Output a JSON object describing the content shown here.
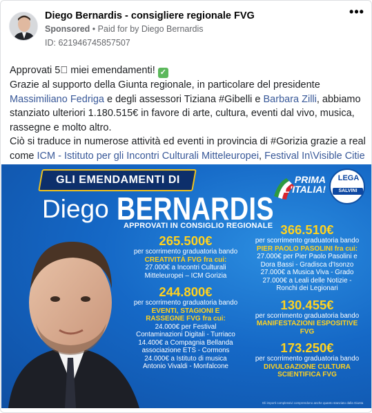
{
  "post": {
    "page_name": "Diego Bernardis - consigliere regionale FVG",
    "sponsored": "Sponsored",
    "paid_for": "Paid for by Diego Bernardis",
    "separator": "•",
    "ad_id": "ID: 621946745857507",
    "more_label": "•••"
  },
  "body": {
    "l1": "Approvati 5⃣ miei emendamenti!",
    "l2": "Grazie al supporto della Giunta regionale, in particolare del presidente",
    "l3_link1": "Massimiliano Fedriga",
    "l3_mid": " e degli assessori Tiziana #Gibelli e ",
    "l3_link2": "Barbara Zilli",
    "l3_end": ", abbiamo",
    "l4": "stanziato ulteriori 1.180.515€ in favore di arte, cultura, eventi dal vivo, musica,",
    "l5": "rassegne e molto altro.",
    "l6": "Ciò si traduce in numerose attività ed eventi in provincia di #Gorizia grazie a realtà",
    "l7_start": "come ",
    "l7_link1": "ICM - Istituto per gli Incontri Culturali Mitteleuropei",
    "l7_mid": ", ",
    "l7_link2": "Festival In\\Visible Citie…"
  },
  "creative": {
    "banner": "GLI EMENDAMENTI DI",
    "first_name": "Diego",
    "last_name": "BERNARDIS",
    "subtitle": "APPROVATI IN CONSIGLIO REGIONALE",
    "prima_line1": "PRIMA",
    "prima_line2": "L'ITALIA!",
    "lega": "LEGA",
    "salvini": "SALVINI",
    "footnote": "Gli importi complessivi comprendono anche quanto stanziato dalla Giunta",
    "left": [
      {
        "amount": "265.500€",
        "d1": "per scorrimento graduatoria bando",
        "hl": [
          "CREATIVITÀ FVG fra cui:"
        ],
        "rest": [
          "27.000€ a Incontri Culturali",
          "Mitteleuropei – ICM Gorizia"
        ]
      },
      {
        "amount": "244.800€",
        "d1": "per scorrimento graduatoria bando",
        "hl": [
          "EVENTI, STAGIONI E",
          "RASSEGNE FVG fra cui:"
        ],
        "rest": [
          "24.000€ per Festival",
          "Contaminazioni Digitali - Turriaco",
          "14.400€ a Compagnia Bellanda",
          "associazione ETS - Cormons",
          "24.000€ a Istituto di musica",
          "Antonio Vivaldi - Monfalcone"
        ]
      }
    ],
    "right": [
      {
        "amount": "366.510€",
        "d1": "per scorrimento graduatoria bando",
        "hl": [
          "PIER PAOLO PASOLINI fra cui:"
        ],
        "rest": [
          "27.000€ per Pier Paolo Pasolini e",
          "Dora Bassi - Gradisca d'Isonzo",
          "27.000€ a Musica Viva - Grado",
          "27.000€ a Leali delle Notizie -",
          "Ronchi dei Legionari"
        ]
      },
      {
        "amount": "130.455€",
        "d1": "per scorrimento graduatoria bando",
        "hl": [
          "MANIFESTAZIONI ESPOSITIVE",
          "FVG"
        ],
        "rest": []
      },
      {
        "amount": "173.250€",
        "d1": "per scorrimento graduatoria bando",
        "hl": [
          "DIVULGAZIONE CULTURA",
          "SCIENTIFICA FVG"
        ],
        "rest": []
      }
    ]
  },
  "colors": {
    "link": "#385898",
    "creative_blue": "#1565c4",
    "accent_yellow": "#ffd21f"
  }
}
